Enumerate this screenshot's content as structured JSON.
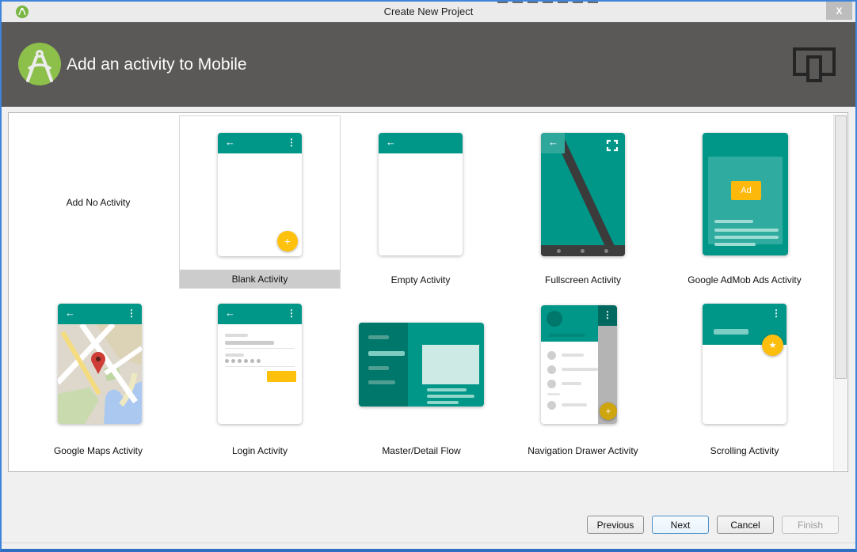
{
  "window": {
    "title": "Create New Project",
    "icons": {
      "close": "X"
    }
  },
  "header": {
    "title": "Add an activity to Mobile"
  },
  "glyphs": {
    "back_arrow": "←",
    "overflow_menu": "⋮",
    "plus": "+",
    "star": "★"
  },
  "activities": [
    {
      "label": "Add No Activity"
    },
    {
      "label": "Blank Activity",
      "selected": true
    },
    {
      "label": "Empty Activity"
    },
    {
      "label": "Fullscreen Activity"
    },
    {
      "label": "Google AdMob Ads Activity",
      "badge": "Ad"
    },
    {
      "label": "Google Maps Activity"
    },
    {
      "label": "Login Activity"
    },
    {
      "label": "Master/Detail Flow"
    },
    {
      "label": "Navigation Drawer Activity"
    },
    {
      "label": "Scrolling Activity"
    }
  ],
  "footer": {
    "buttons": [
      {
        "label": "Previous",
        "state": "enabled"
      },
      {
        "label": "Next",
        "state": "default"
      },
      {
        "label": "Cancel",
        "state": "enabled"
      },
      {
        "label": "Finish",
        "state": "disabled"
      }
    ]
  },
  "colors": {
    "teal": "#009688",
    "teal_dark": "#00776b",
    "teal_light": "#2fab9f",
    "amber": "#fec10d",
    "amber_dim": "#cfa50e",
    "header_bg": "#5b5958",
    "selection_bg": "#cccccc",
    "window_border": "#3f83da"
  }
}
